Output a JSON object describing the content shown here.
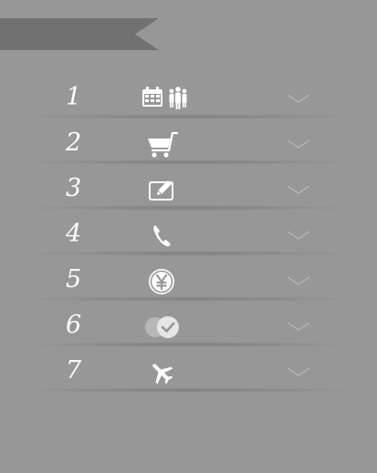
{
  "banner": {
    "label": ""
  },
  "steps": [
    {
      "number": "1",
      "icon": "calendar-people-icon"
    },
    {
      "number": "2",
      "icon": "shopping-cart-icon"
    },
    {
      "number": "3",
      "icon": "edit-note-icon"
    },
    {
      "number": "4",
      "icon": "phone-icon"
    },
    {
      "number": "5",
      "icon": "yen-coin-icon"
    },
    {
      "number": "6",
      "icon": "toggle-check-icon"
    },
    {
      "number": "7",
      "icon": "airplane-icon"
    }
  ],
  "colors": {
    "background": "#979797",
    "banner": "#717171",
    "icon": "#ffffff",
    "chevron": "#b9b9b9"
  }
}
